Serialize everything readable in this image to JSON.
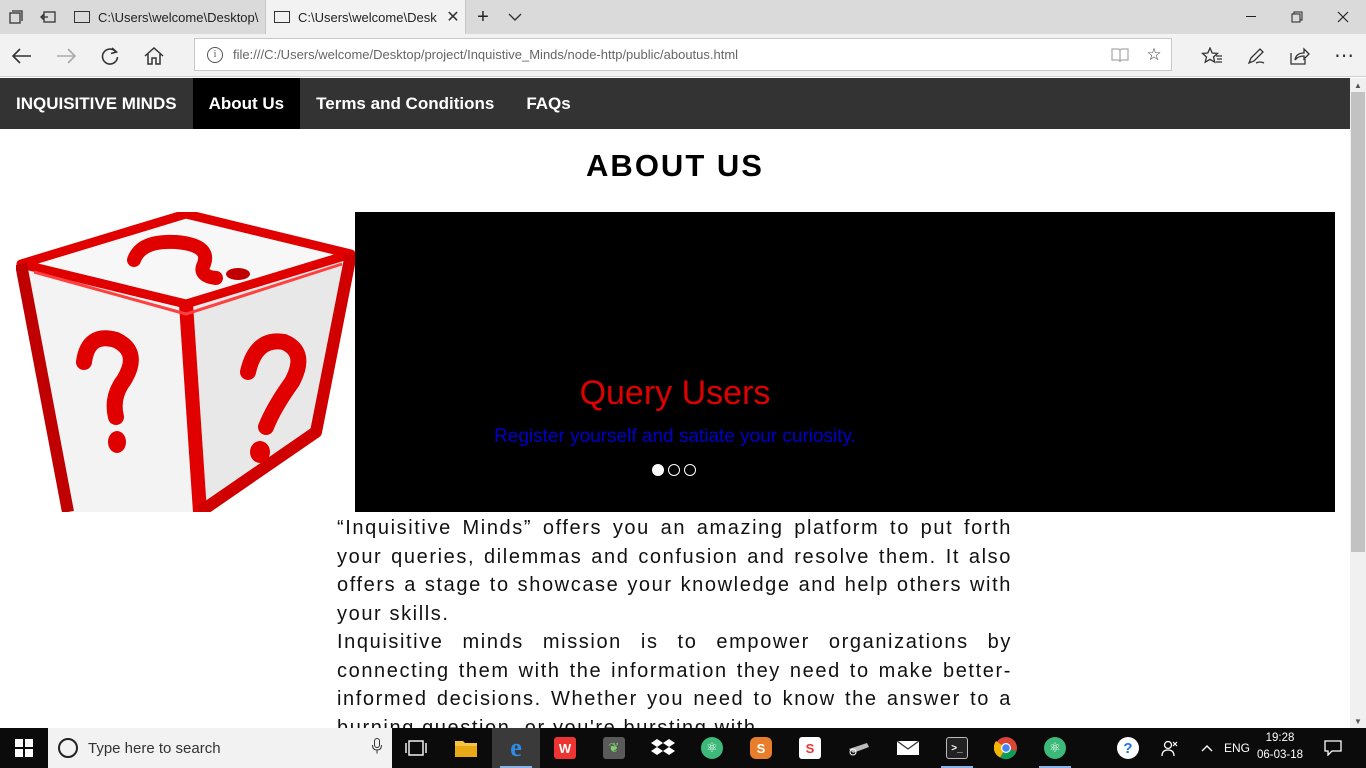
{
  "browser": {
    "tabs": [
      {
        "title": "C:\\Users\\welcome\\Desktop\\",
        "active": false
      },
      {
        "title": "C:\\Users\\welcome\\Desk",
        "active": true
      }
    ],
    "new_tab_label": "+",
    "url": "file:///C:/Users/welcome/Desktop/project/Inquistive_Minds/node-http/public/aboutus.html"
  },
  "nav": {
    "brand": "INQUISITIVE MINDS",
    "items": [
      {
        "label": "About Us",
        "active": true
      },
      {
        "label": "Terms and Conditions",
        "active": false
      },
      {
        "label": "FAQs",
        "active": false
      }
    ]
  },
  "page": {
    "heading": "ABOUT US",
    "carousel": {
      "title": "Query Users",
      "subtitle": "Register yourself and satiate your curiosity.",
      "slide_count": 3,
      "active_index": 0,
      "title_color": "#e00000",
      "subtitle_color": "#0000cc"
    },
    "paragraphs": [
      "“Inquisitive Minds” offers you an amazing platform to put forth your queries, dilemmas and confusion and resolve them. It also offers a stage to showcase your knowledge and help others with your skills.",
      "Inquisitive minds mission is to empower organizations by connecting them with the information they need to make better-informed decisions. Whether you need to know the answer to a burning question, or you're bursting with"
    ]
  },
  "taskbar": {
    "search_placeholder": "Type here to search",
    "language": "ENG",
    "time": "19:28",
    "date": "06-03-18"
  },
  "colors": {
    "nav_bg": "#333333",
    "nav_active_bg": "#000000",
    "cube_red": "#e00000"
  }
}
